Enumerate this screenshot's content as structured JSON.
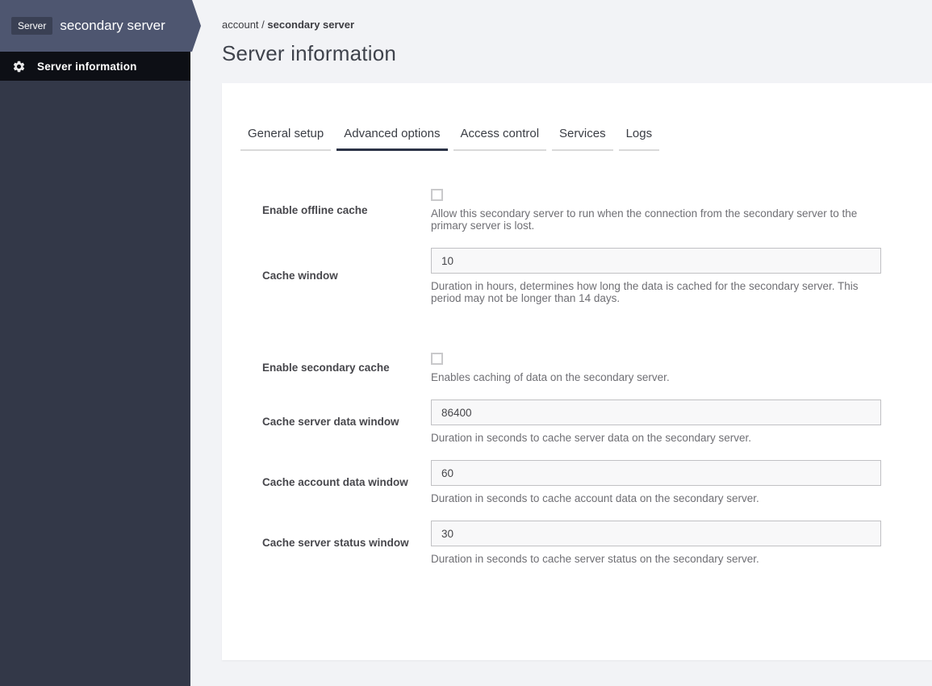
{
  "sidebar": {
    "badge": "Server",
    "title": "secondary server",
    "nav_item": {
      "icon": "gear-icon",
      "label": "Server information"
    }
  },
  "breadcrumb": {
    "parent": "account",
    "separator": " / ",
    "current": "secondary server"
  },
  "page": {
    "title": "Server information"
  },
  "tabs": [
    {
      "label": "General setup",
      "active": false
    },
    {
      "label": "Advanced options",
      "active": true
    },
    {
      "label": "Access control",
      "active": false
    },
    {
      "label": "Services",
      "active": false
    },
    {
      "label": "Logs",
      "active": false
    }
  ],
  "form": {
    "fields": [
      {
        "type": "checkbox",
        "label": "Enable offline cache",
        "checked": false,
        "help": "Allow this secondary server to run when the connection from the secondary server to the primary server is lost."
      },
      {
        "type": "text",
        "label": "Cache window",
        "value": "10",
        "help": "Duration in hours, determines how long the data is cached for the secondary server. This period may not be longer than 14 days."
      },
      {
        "type": "checkbox",
        "label": "Enable secondary cache",
        "checked": false,
        "section_break": true,
        "help": "Enables caching of data on the secondary server."
      },
      {
        "type": "text",
        "label": "Cache server data window",
        "value": "86400",
        "help": "Duration in seconds to cache server data on the secondary server."
      },
      {
        "type": "text",
        "label": "Cache account data window",
        "value": "60",
        "help": "Duration in seconds to cache account data on the secondary server."
      },
      {
        "type": "text",
        "label": "Cache server status window",
        "value": "30",
        "help": "Duration in seconds to cache server status on the secondary server."
      }
    ]
  },
  "colors": {
    "sidebar_header": "#4e5670",
    "sidebar_badge": "#3a4054",
    "sidebar_body": "#333848",
    "sidebar_nav": "#0d0f15",
    "active_tab_underline": "#2b3346",
    "page_background": "#f2f3f6",
    "card_background": "#ffffff",
    "input_background": "#f8f8f9",
    "input_border": "#c1c1c4"
  }
}
